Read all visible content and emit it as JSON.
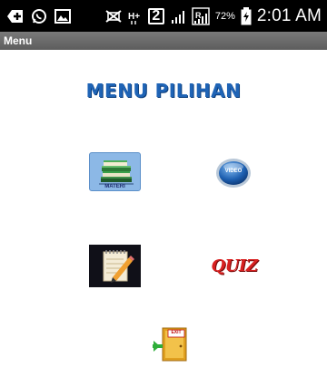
{
  "status_bar": {
    "time": "2:01 AM",
    "battery_percent": "72%",
    "sim_slot": "2",
    "network_type": "H+",
    "icons": [
      "add-icon",
      "whatsapp-icon",
      "image-icon",
      "mute-icon",
      "network-h-plus-icon",
      "sim-2-icon",
      "signal-icon",
      "signal-r-icon",
      "battery-charging-icon"
    ]
  },
  "action_bar": {
    "title": "Menu"
  },
  "main": {
    "title": "MENU PILIHAN",
    "buttons": {
      "materi": {
        "label": "MATERI",
        "icon": "books-icon"
      },
      "video": {
        "label": "VIDEO",
        "icon": "video-icon"
      },
      "notes": {
        "icon": "notepad-pencil-icon"
      },
      "quiz": {
        "label": "QUIZ",
        "icon": "quiz-icon"
      },
      "exit": {
        "label": "EXIT",
        "icon": "exit-door-icon"
      }
    }
  },
  "colors": {
    "title": "#1f64b6",
    "status_bar": "#000000",
    "action_bar": "#6b6b6b",
    "materi_bg": "#8cb8e6",
    "quiz_text": "#d82020"
  }
}
